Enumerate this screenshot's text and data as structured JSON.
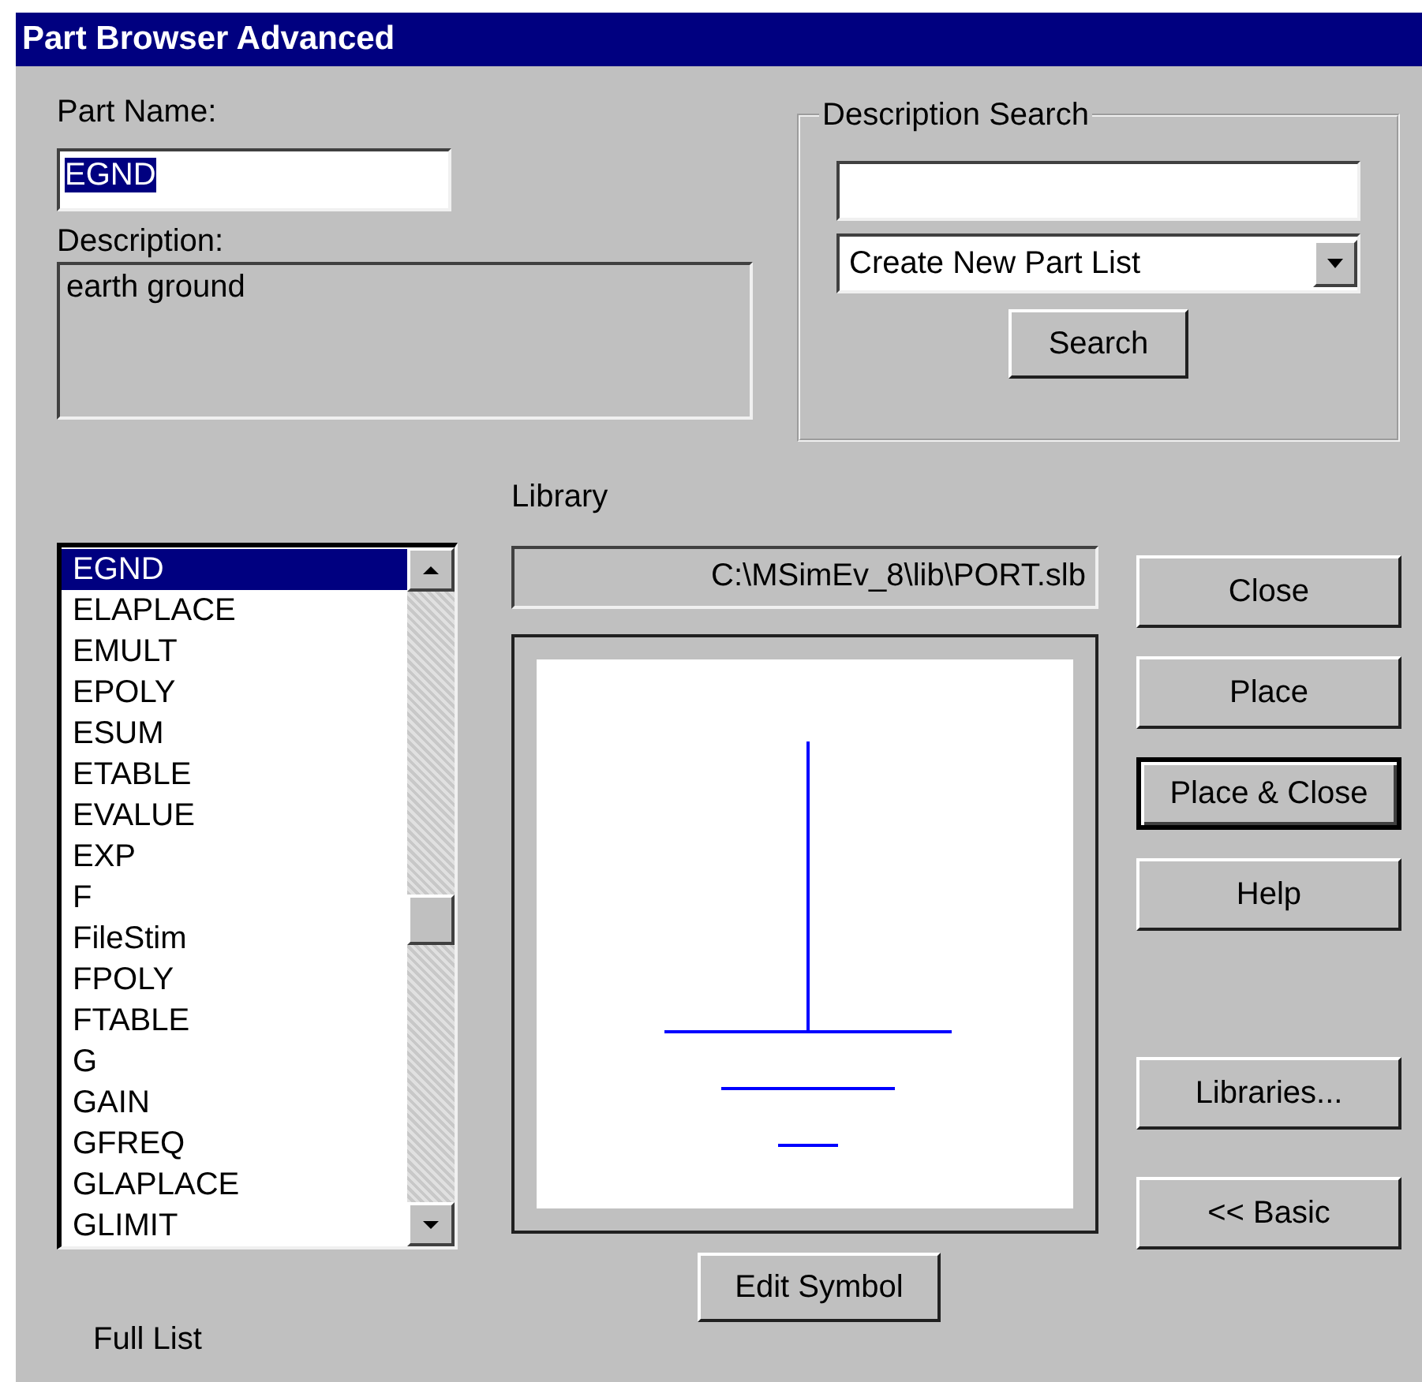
{
  "window": {
    "title": "Part Browser Advanced"
  },
  "part_name": {
    "label": "Part Name:",
    "value": "EGND",
    "value_selected": true
  },
  "description": {
    "label": "Description:",
    "value": "earth ground"
  },
  "description_search": {
    "title": "Description Search",
    "dropdown": "Create New Part List",
    "button": "Search"
  },
  "library": {
    "label": "Library",
    "path": "C:\\MSimEv_8\\lib\\PORT.slb"
  },
  "parts": [
    {
      "name": "EGND",
      "selected": true
    },
    {
      "name": "ELAPLACE",
      "selected": false
    },
    {
      "name": "EMULT",
      "selected": false
    },
    {
      "name": "EPOLY",
      "selected": false
    },
    {
      "name": "ESUM",
      "selected": false
    },
    {
      "name": "ETABLE",
      "selected": false
    },
    {
      "name": "EVALUE",
      "selected": false
    },
    {
      "name": "EXP",
      "selected": false
    },
    {
      "name": "F",
      "selected": false
    },
    {
      "name": "FileStim",
      "selected": false
    },
    {
      "name": "FPOLY",
      "selected": false
    },
    {
      "name": "FTABLE",
      "selected": false
    },
    {
      "name": "G",
      "selected": false
    },
    {
      "name": "GAIN",
      "selected": false
    },
    {
      "name": "GFREQ",
      "selected": false
    },
    {
      "name": "GLAPLACE",
      "selected": false
    },
    {
      "name": "GLIMIT",
      "selected": false
    }
  ],
  "list_mode": "Full List",
  "edit_symbol_button": "Edit Symbol",
  "buttons": [
    {
      "label": "Close",
      "default": false
    },
    {
      "label": "Place",
      "default": false
    },
    {
      "label": "Place & Close",
      "default": true
    },
    {
      "label": "Help",
      "default": false
    },
    {
      "label": "Libraries...",
      "default": false
    },
    {
      "label": "<< Basic",
      "default": false
    }
  ]
}
